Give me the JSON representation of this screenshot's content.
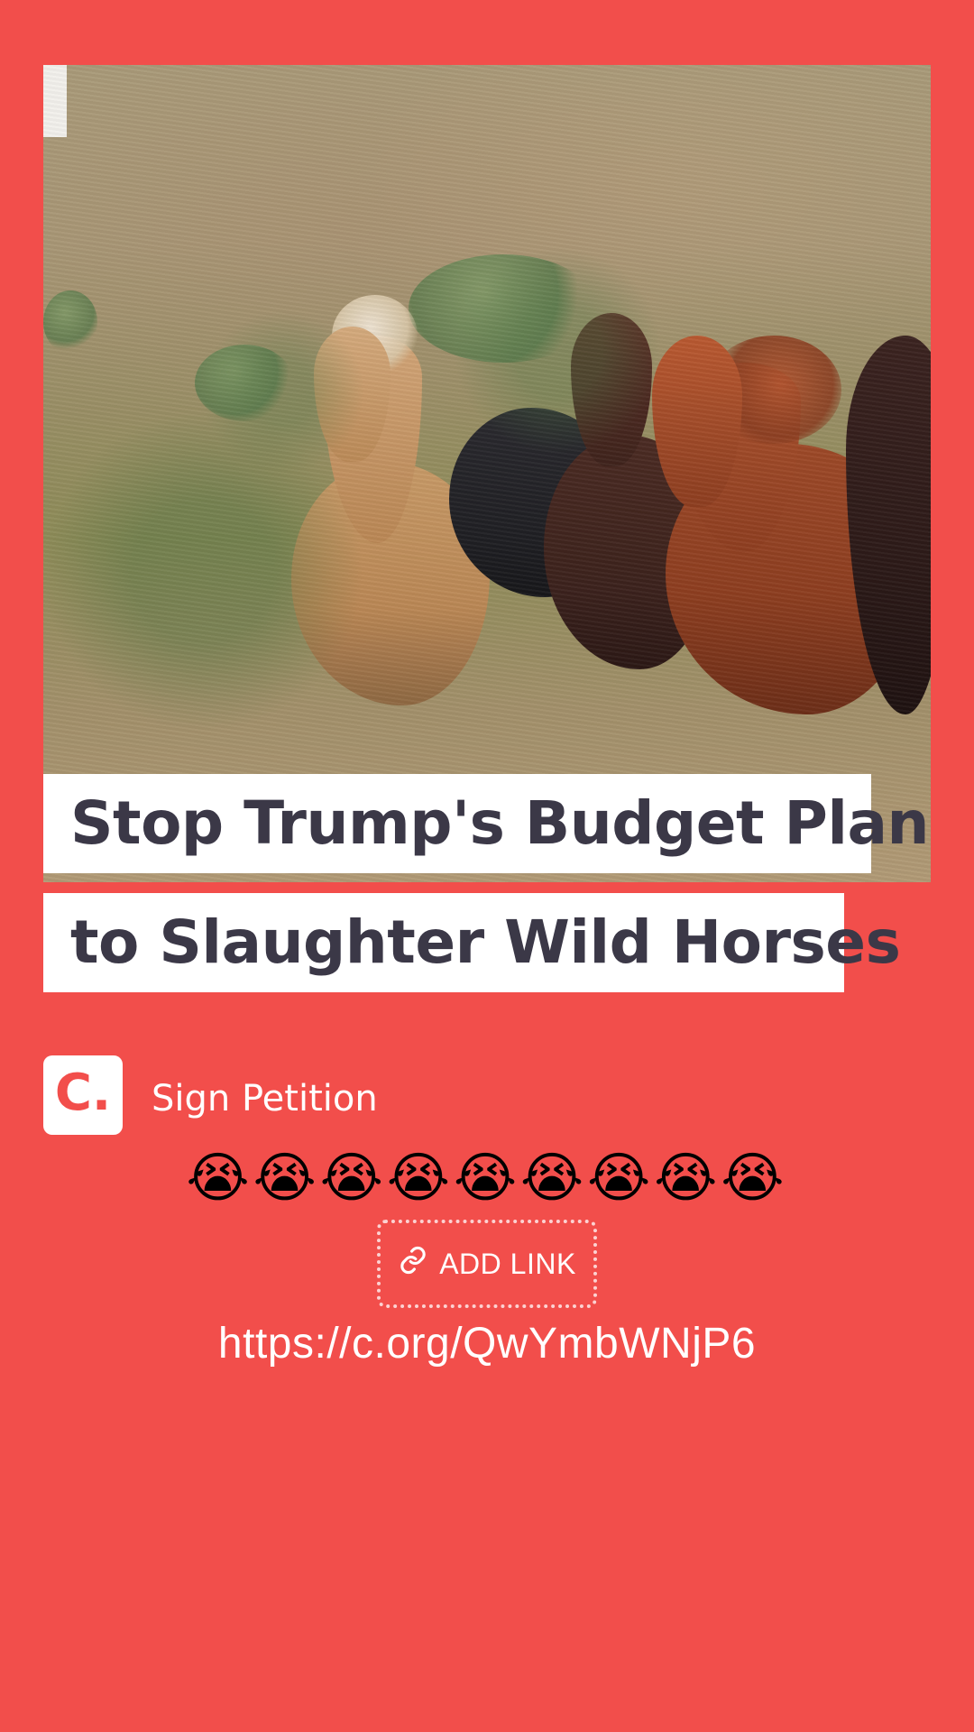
{
  "title_lines": [
    "Stop Trump's Budget Plan",
    "to Slaughter Wild Horses"
  ],
  "brand": {
    "logo_text": "C."
  },
  "cta": {
    "sign_petition_label": "Sign Petition",
    "emojis": "😭😭😭😭😭😭😭😭😭",
    "add_link_label": "ADD LINK",
    "url": "https://c.org/QwYmbWNjP6"
  },
  "icons": {
    "add_link_icon": "link-icon"
  },
  "colors": {
    "background": "#f24e4b",
    "title_text": "#3b3847",
    "title_bg": "#ffffff",
    "cta_text": "#ffffff"
  }
}
